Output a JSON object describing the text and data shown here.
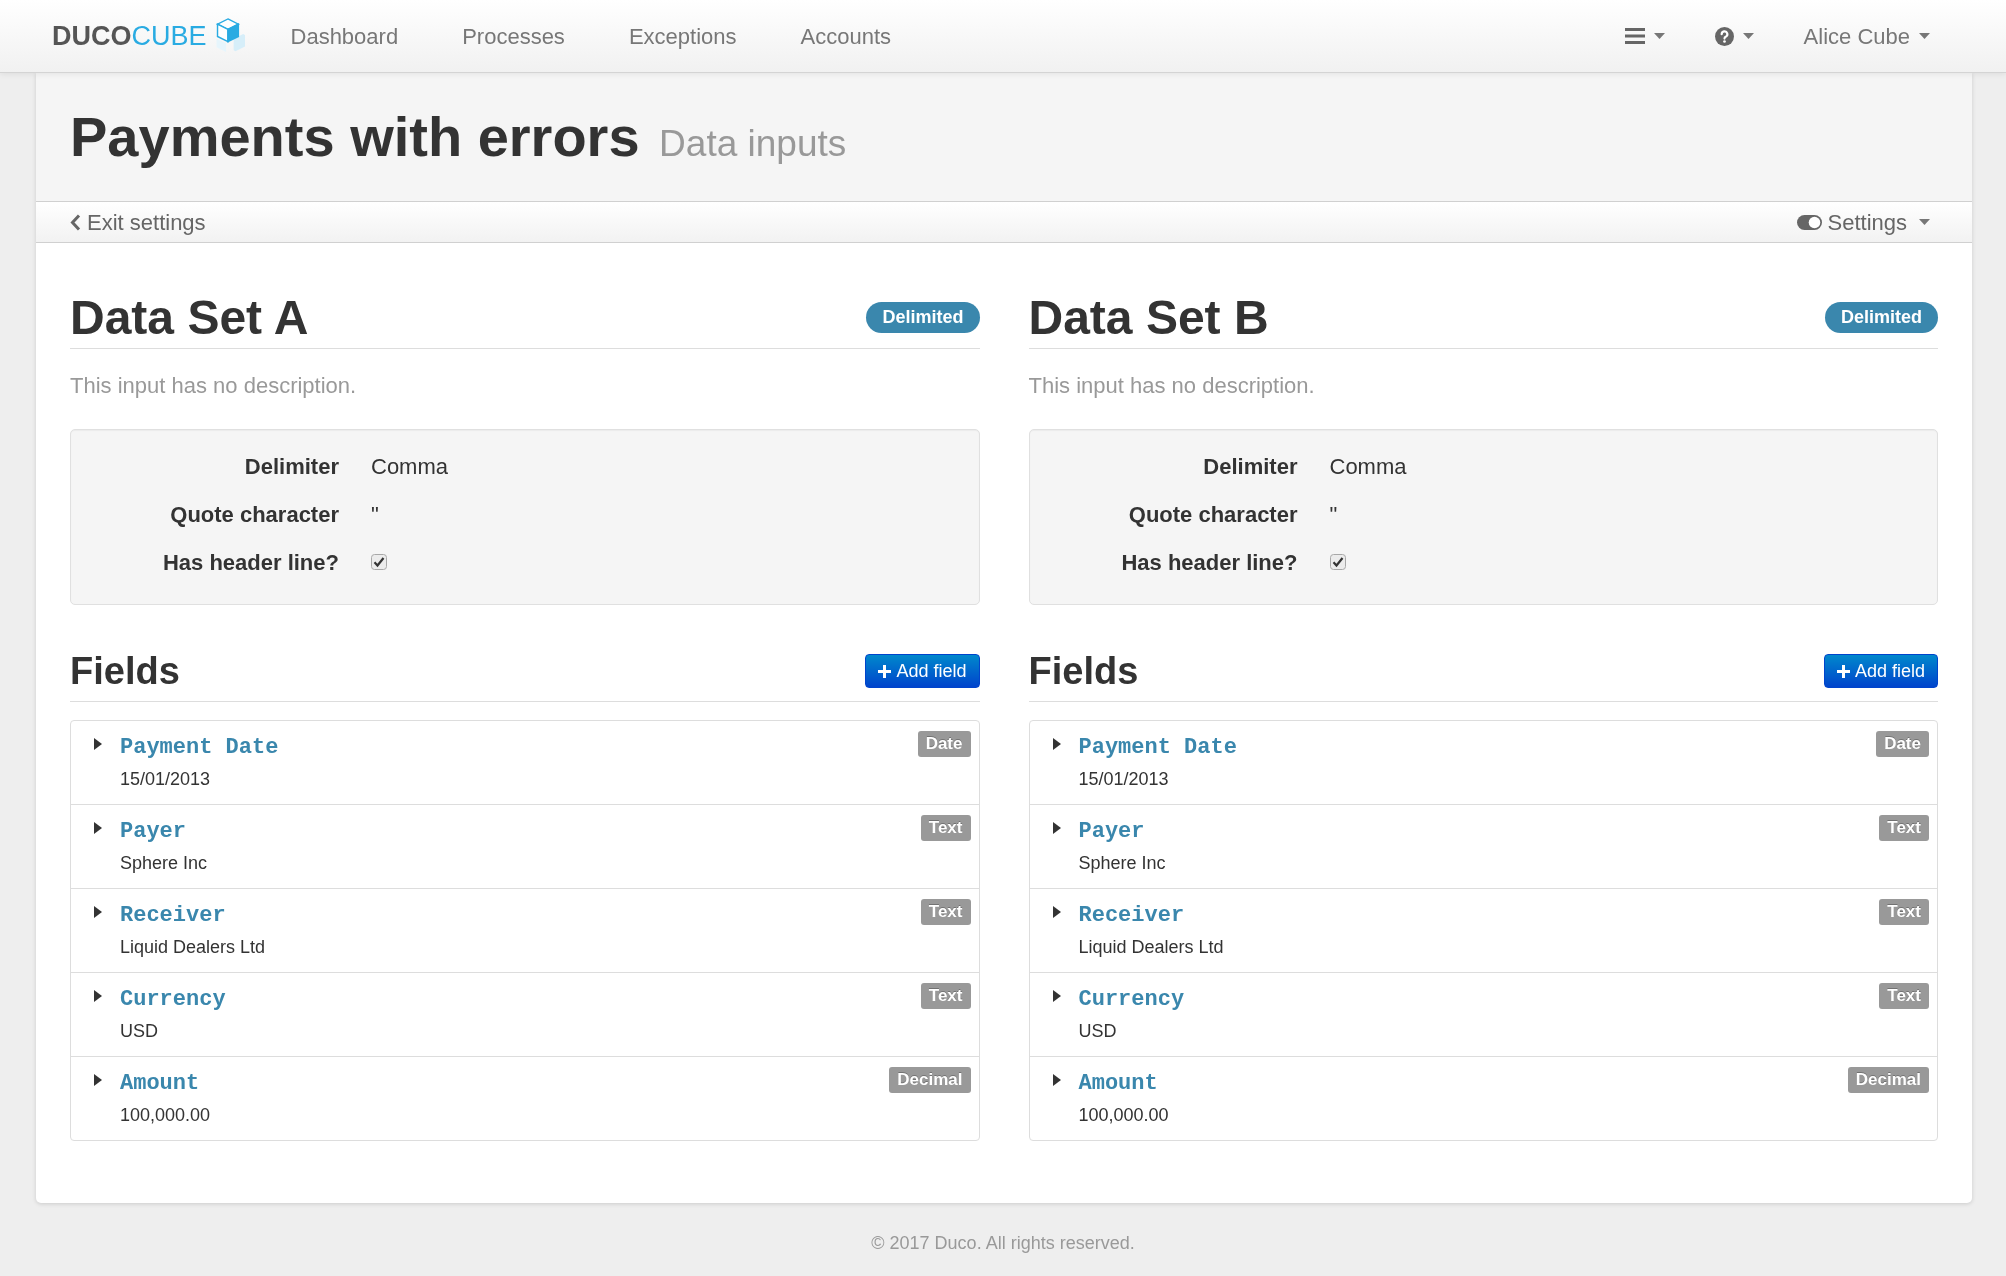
{
  "navbar": {
    "logo": {
      "first_word": "DUCO",
      "second_word": "CUBE"
    },
    "links": [
      "Dashboard",
      "Processes",
      "Exceptions",
      "Accounts"
    ],
    "user_menu": "Alice Cube"
  },
  "page_header": {
    "title": "Payments with errors",
    "subtitle": "Data inputs"
  },
  "settings_bar": {
    "back_link": "Exit settings",
    "settings_menu": "Settings"
  },
  "data_sets": [
    {
      "title": "Data Set A",
      "format_badge": "Delimited",
      "description": "This input has no description.",
      "properties": [
        {
          "kind": "text",
          "label": "Delimiter",
          "value": "Comma"
        },
        {
          "kind": "text",
          "label": "Quote character",
          "value": "\""
        },
        {
          "kind": "checkbox",
          "label": "Has header line?",
          "checked": true
        }
      ],
      "fields_heading": "Fields",
      "add_button": "Add field",
      "fields": [
        {
          "name": "Payment Date",
          "sample": "15/01/2013",
          "type": "Date",
          "expanded": false
        },
        {
          "name": "Payer",
          "sample": "Sphere Inc",
          "type": "Text",
          "expanded": false
        },
        {
          "name": "Receiver",
          "sample": "Liquid Dealers Ltd",
          "type": "Text",
          "expanded": false
        },
        {
          "name": "Currency",
          "sample": "USD",
          "type": "Text",
          "expanded": false
        },
        {
          "name": "Amount",
          "sample": "100,000.00",
          "type": "Decimal",
          "expanded": false
        }
      ]
    },
    {
      "title": "Data Set B",
      "format_badge": "Delimited",
      "description": "This input has no description.",
      "properties": [
        {
          "kind": "text",
          "label": "Delimiter",
          "value": "Comma"
        },
        {
          "kind": "text",
          "label": "Quote character",
          "value": "\""
        },
        {
          "kind": "checkbox",
          "label": "Has header line?",
          "checked": true
        }
      ],
      "fields_heading": "Fields",
      "add_button": "Add field",
      "fields": [
        {
          "name": "Payment Date",
          "sample": "15/01/2013",
          "type": "Date",
          "expanded": false
        },
        {
          "name": "Payer",
          "sample": "Sphere Inc",
          "type": "Text",
          "expanded": false
        },
        {
          "name": "Receiver",
          "sample": "Liquid Dealers Ltd",
          "type": "Text",
          "expanded": false
        },
        {
          "name": "Currency",
          "sample": "USD",
          "type": "Text",
          "expanded": false
        },
        {
          "name": "Amount",
          "sample": "100,000.00",
          "type": "Decimal",
          "expanded": false
        }
      ]
    }
  ],
  "footer": "© 2017 Duco. All rights reserved."
}
